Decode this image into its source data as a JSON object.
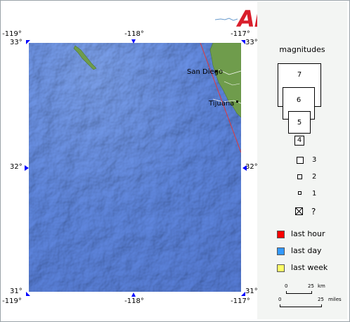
{
  "axes": {
    "top": [
      "-119°",
      "-118°",
      "-117°"
    ],
    "bottom": [
      "-119°",
      "-118°",
      "-117°"
    ],
    "left": [
      "33°",
      "32°",
      "31°"
    ],
    "right": [
      "33°",
      "32°",
      "31°"
    ]
  },
  "places": {
    "san_diego": "San Diego",
    "tijuana": "Tijuana"
  },
  "logo": {
    "text": "ANSS"
  },
  "legend": {
    "title": "magnitudes",
    "magnitudes": [
      "7",
      "6",
      "5",
      "4",
      "3",
      "2",
      "1",
      "?"
    ],
    "time_classes": [
      {
        "label": "last hour",
        "color": "#ff0000"
      },
      {
        "label": "last day",
        "color": "#3399ff"
      },
      {
        "label": "last week",
        "color": "#ffff66"
      }
    ],
    "scale": {
      "km_start": "0",
      "km_end": "25",
      "km_unit": "km",
      "mi_start": "0",
      "mi_end": "25",
      "mi_unit": "miles"
    }
  },
  "colors": {
    "ocean": "#5f86e0",
    "land": "#6f9c4c",
    "marker": "#0000ff",
    "fault": "#e0383c"
  }
}
